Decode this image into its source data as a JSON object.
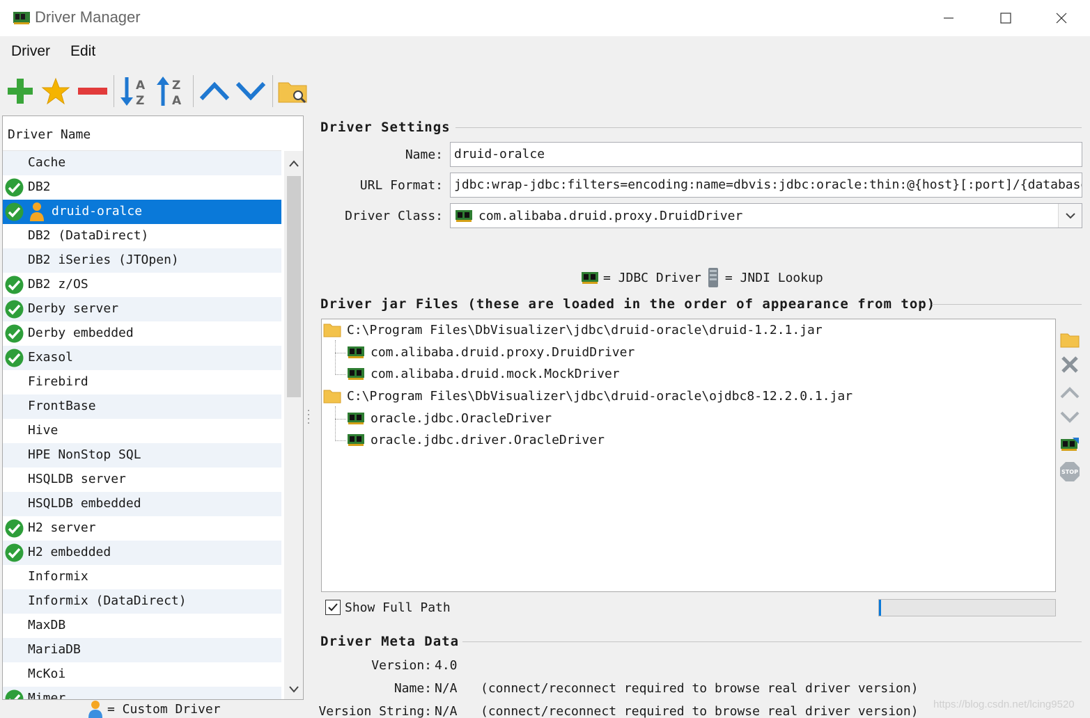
{
  "window": {
    "title": "Driver Manager"
  },
  "menu": {
    "items": [
      "Driver",
      "Edit"
    ]
  },
  "toolbar": {
    "buttons": [
      {
        "icon": "add-icon"
      },
      {
        "icon": "star-icon"
      },
      {
        "icon": "remove-icon"
      },
      {
        "icon": "sort-az-icon"
      },
      {
        "icon": "sort-za-icon"
      },
      {
        "icon": "move-up-icon"
      },
      {
        "icon": "move-down-icon"
      },
      {
        "icon": "find-folder-icon"
      }
    ]
  },
  "driver_list": {
    "header": "Driver Name",
    "selected_index": 2,
    "rows": [
      {
        "label": "Cache",
        "ok": false,
        "custom": false
      },
      {
        "label": "DB2",
        "ok": true,
        "custom": false
      },
      {
        "label": "druid-oralce",
        "ok": true,
        "custom": true
      },
      {
        "label": "DB2 (DataDirect)",
        "ok": false,
        "custom": false
      },
      {
        "label": "DB2 iSeries (JTOpen)",
        "ok": false,
        "custom": false
      },
      {
        "label": "DB2 z/OS",
        "ok": true,
        "custom": false
      },
      {
        "label": "Derby server",
        "ok": true,
        "custom": false
      },
      {
        "label": "Derby embedded",
        "ok": true,
        "custom": false
      },
      {
        "label": "Exasol",
        "ok": true,
        "custom": false
      },
      {
        "label": "Firebird",
        "ok": false,
        "custom": false
      },
      {
        "label": "FrontBase",
        "ok": false,
        "custom": false
      },
      {
        "label": "Hive",
        "ok": false,
        "custom": false
      },
      {
        "label": "HPE NonStop SQL",
        "ok": false,
        "custom": false
      },
      {
        "label": "HSQLDB server",
        "ok": false,
        "custom": false
      },
      {
        "label": "HSQLDB embedded",
        "ok": false,
        "custom": false
      },
      {
        "label": "H2 server",
        "ok": true,
        "custom": false
      },
      {
        "label": "H2 embedded",
        "ok": true,
        "custom": false
      },
      {
        "label": "Informix",
        "ok": false,
        "custom": false
      },
      {
        "label": "Informix (DataDirect)",
        "ok": false,
        "custom": false
      },
      {
        "label": "MaxDB",
        "ok": false,
        "custom": false
      },
      {
        "label": "MariaDB",
        "ok": false,
        "custom": false
      },
      {
        "label": "McKoi",
        "ok": false,
        "custom": false
      },
      {
        "label": "Mimer",
        "ok": true,
        "custom": false
      }
    ],
    "legend": "= Custom Driver"
  },
  "settings": {
    "section_title": "Driver Settings",
    "name_label": "Name:",
    "name_value": "druid-oralce",
    "url_label": "URL Format:",
    "url_value": "jdbc:wrap-jdbc:filters=encoding:name=dbvis:jdbc:oracle:thin:@{host}[:port]/{database}",
    "class_label": "Driver Class:",
    "class_value": "com.alibaba.druid.proxy.DruidDriver",
    "legend_jdbc": "= JDBC Driver",
    "legend_jndi": "= JNDI Lookup"
  },
  "jars": {
    "section_title": "Driver jar Files (these are loaded in the order of appearance from top)",
    "files": [
      {
        "path": "C:\\Program Files\\DbVisualizer\\jdbc\\druid-oracle\\druid-1.2.1.jar",
        "classes": [
          "com.alibaba.druid.proxy.DruidDriver",
          "com.alibaba.druid.mock.MockDriver"
        ]
      },
      {
        "path": "C:\\Program Files\\DbVisualizer\\jdbc\\druid-oracle\\ojdbc8-12.2.0.1.jar",
        "classes": [
          "oracle.jdbc.OracleDriver",
          "oracle.jdbc.driver.OracleDriver"
        ]
      }
    ],
    "show_full_path_label": "Show Full Path",
    "show_full_path_checked": true,
    "progress_fraction": 0.01
  },
  "meta": {
    "section_title": "Driver Meta Data",
    "version_label": "Version:",
    "version_value": "4.0",
    "name_label": "Name:",
    "name_value": "N/A",
    "name_note": "(connect/reconnect required to browse real driver version)",
    "vstring_label": "Version String:",
    "vstring_value": "N/A",
    "vstring_note": "(connect/reconnect required to browse real driver version)"
  },
  "watermark": "https://blog.csdn.net/lcing9520",
  "colors": {
    "selection": "#0a79d9",
    "ok_green": "#2e9e3a",
    "add_green": "#3aa53a",
    "remove_red": "#e23b3b",
    "arrow_blue": "#1f78d1",
    "star_yellow": "#f5b400"
  }
}
